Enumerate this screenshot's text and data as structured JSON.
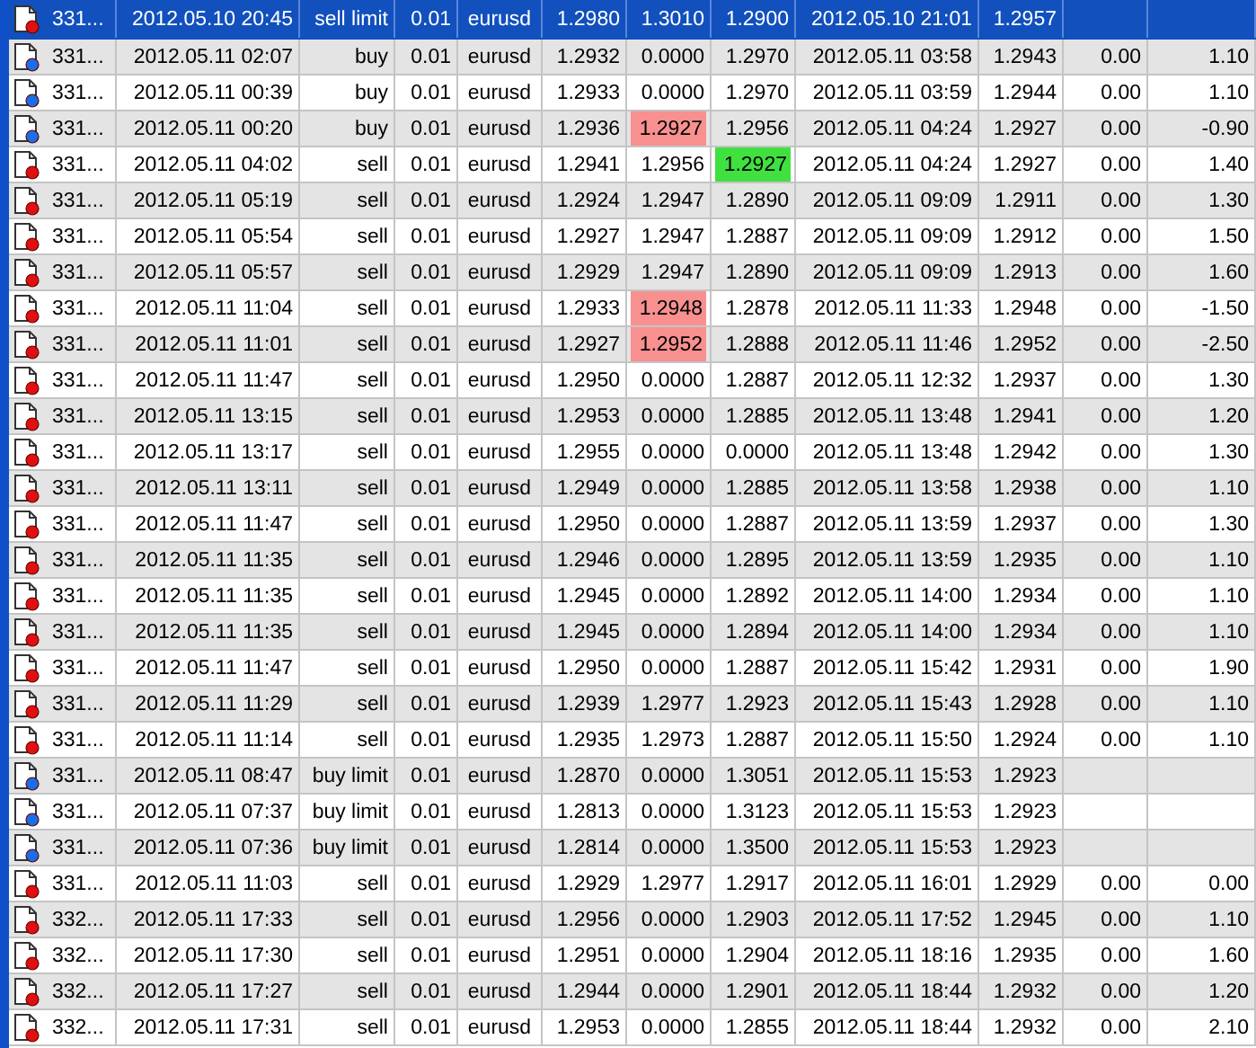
{
  "table": {
    "rows": [
      {
        "kind": "sell",
        "selected": true,
        "hit_column_7": false,
        "hit_column_8": false,
        "cells": [
          "331...",
          "2012.05.10 20:45",
          "sell limit",
          "0.01",
          "eurusd",
          "1.2980",
          "1.3010",
          "1.2900",
          "2012.05.10 21:01",
          "1.2957"
        ]
      },
      {
        "kind": "buy",
        "selected": false,
        "hit_column_7": false,
        "hit_column_8": false,
        "cells": [
          "331...",
          "2012.05.11 02:07",
          "buy",
          "0.01",
          "eurusd",
          "1.2932",
          "0.0000",
          "1.2970",
          "2012.05.11 03:58",
          "1.2943",
          "0.00",
          "1.10"
        ]
      },
      {
        "kind": "buy",
        "selected": false,
        "hit_column_7": false,
        "hit_column_8": false,
        "cells": [
          "331...",
          "2012.05.11 00:39",
          "buy",
          "0.01",
          "eurusd",
          "1.2933",
          "0.0000",
          "1.2970",
          "2012.05.11 03:59",
          "1.2944",
          "0.00",
          "1.10"
        ]
      },
      {
        "kind": "buy",
        "selected": false,
        "hit_column_7": true,
        "hit_column_8": false,
        "cells": [
          "331...",
          "2012.05.11 00:20",
          "buy",
          "0.01",
          "eurusd",
          "1.2936",
          "1.2927",
          "1.2956",
          "2012.05.11 04:24",
          "1.2927",
          "0.00",
          "-0.90"
        ]
      },
      {
        "kind": "sell",
        "selected": false,
        "hit_column_7": false,
        "hit_column_8": true,
        "cells": [
          "331...",
          "2012.05.11 04:02",
          "sell",
          "0.01",
          "eurusd",
          "1.2941",
          "1.2956",
          "1.2927",
          "2012.05.11 04:24",
          "1.2927",
          "0.00",
          "1.40"
        ]
      },
      {
        "kind": "sell",
        "selected": false,
        "hit_column_7": false,
        "hit_column_8": false,
        "cells": [
          "331...",
          "2012.05.11 05:19",
          "sell",
          "0.01",
          "eurusd",
          "1.2924",
          "1.2947",
          "1.2890",
          "2012.05.11 09:09",
          "1.2911",
          "0.00",
          "1.30"
        ]
      },
      {
        "kind": "sell",
        "selected": false,
        "hit_column_7": false,
        "hit_column_8": false,
        "cells": [
          "331...",
          "2012.05.11 05:54",
          "sell",
          "0.01",
          "eurusd",
          "1.2927",
          "1.2947",
          "1.2887",
          "2012.05.11 09:09",
          "1.2912",
          "0.00",
          "1.50"
        ]
      },
      {
        "kind": "sell",
        "selected": false,
        "hit_column_7": false,
        "hit_column_8": false,
        "cells": [
          "331...",
          "2012.05.11 05:57",
          "sell",
          "0.01",
          "eurusd",
          "1.2929",
          "1.2947",
          "1.2890",
          "2012.05.11 09:09",
          "1.2913",
          "0.00",
          "1.60"
        ]
      },
      {
        "kind": "sell",
        "selected": false,
        "hit_column_7": true,
        "hit_column_8": false,
        "cells": [
          "331...",
          "2012.05.11 11:04",
          "sell",
          "0.01",
          "eurusd",
          "1.2933",
          "1.2948",
          "1.2878",
          "2012.05.11 11:33",
          "1.2948",
          "0.00",
          "-1.50"
        ]
      },
      {
        "kind": "sell",
        "selected": false,
        "hit_column_7": true,
        "hit_column_8": false,
        "cells": [
          "331...",
          "2012.05.11 11:01",
          "sell",
          "0.01",
          "eurusd",
          "1.2927",
          "1.2952",
          "1.2888",
          "2012.05.11 11:46",
          "1.2952",
          "0.00",
          "-2.50"
        ]
      },
      {
        "kind": "sell",
        "selected": false,
        "hit_column_7": false,
        "hit_column_8": false,
        "cells": [
          "331...",
          "2012.05.11 11:47",
          "sell",
          "0.01",
          "eurusd",
          "1.2950",
          "0.0000",
          "1.2887",
          "2012.05.11 12:32",
          "1.2937",
          "0.00",
          "1.30"
        ]
      },
      {
        "kind": "sell",
        "selected": false,
        "hit_column_7": false,
        "hit_column_8": false,
        "cells": [
          "331...",
          "2012.05.11 13:15",
          "sell",
          "0.01",
          "eurusd",
          "1.2953",
          "0.0000",
          "1.2885",
          "2012.05.11 13:48",
          "1.2941",
          "0.00",
          "1.20"
        ]
      },
      {
        "kind": "sell",
        "selected": false,
        "hit_column_7": false,
        "hit_column_8": false,
        "cells": [
          "331...",
          "2012.05.11 13:17",
          "sell",
          "0.01",
          "eurusd",
          "1.2955",
          "0.0000",
          "0.0000",
          "2012.05.11 13:48",
          "1.2942",
          "0.00",
          "1.30"
        ]
      },
      {
        "kind": "sell",
        "selected": false,
        "hit_column_7": false,
        "hit_column_8": false,
        "cells": [
          "331...",
          "2012.05.11 13:11",
          "sell",
          "0.01",
          "eurusd",
          "1.2949",
          "0.0000",
          "1.2885",
          "2012.05.11 13:58",
          "1.2938",
          "0.00",
          "1.10"
        ]
      },
      {
        "kind": "sell",
        "selected": false,
        "hit_column_7": false,
        "hit_column_8": false,
        "cells": [
          "331...",
          "2012.05.11 11:47",
          "sell",
          "0.01",
          "eurusd",
          "1.2950",
          "0.0000",
          "1.2887",
          "2012.05.11 13:59",
          "1.2937",
          "0.00",
          "1.30"
        ]
      },
      {
        "kind": "sell",
        "selected": false,
        "hit_column_7": false,
        "hit_column_8": false,
        "cells": [
          "331...",
          "2012.05.11 11:35",
          "sell",
          "0.01",
          "eurusd",
          "1.2946",
          "0.0000",
          "1.2895",
          "2012.05.11 13:59",
          "1.2935",
          "0.00",
          "1.10"
        ]
      },
      {
        "kind": "sell",
        "selected": false,
        "hit_column_7": false,
        "hit_column_8": false,
        "cells": [
          "331...",
          "2012.05.11 11:35",
          "sell",
          "0.01",
          "eurusd",
          "1.2945",
          "0.0000",
          "1.2892",
          "2012.05.11 14:00",
          "1.2934",
          "0.00",
          "1.10"
        ]
      },
      {
        "kind": "sell",
        "selected": false,
        "hit_column_7": false,
        "hit_column_8": false,
        "cells": [
          "331...",
          "2012.05.11 11:35",
          "sell",
          "0.01",
          "eurusd",
          "1.2945",
          "0.0000",
          "1.2894",
          "2012.05.11 14:00",
          "1.2934",
          "0.00",
          "1.10"
        ]
      },
      {
        "kind": "sell",
        "selected": false,
        "hit_column_7": false,
        "hit_column_8": false,
        "cells": [
          "331...",
          "2012.05.11 11:47",
          "sell",
          "0.01",
          "eurusd",
          "1.2950",
          "0.0000",
          "1.2887",
          "2012.05.11 15:42",
          "1.2931",
          "0.00",
          "1.90"
        ]
      },
      {
        "kind": "sell",
        "selected": false,
        "hit_column_7": false,
        "hit_column_8": false,
        "cells": [
          "331...",
          "2012.05.11 11:29",
          "sell",
          "0.01",
          "eurusd",
          "1.2939",
          "1.2977",
          "1.2923",
          "2012.05.11 15:43",
          "1.2928",
          "0.00",
          "1.10"
        ]
      },
      {
        "kind": "sell",
        "selected": false,
        "hit_column_7": false,
        "hit_column_8": false,
        "cells": [
          "331...",
          "2012.05.11 11:14",
          "sell",
          "0.01",
          "eurusd",
          "1.2935",
          "1.2973",
          "1.2887",
          "2012.05.11 15:50",
          "1.2924",
          "0.00",
          "1.10"
        ]
      },
      {
        "kind": "buy",
        "selected": false,
        "hit_column_7": false,
        "hit_column_8": false,
        "cells": [
          "331...",
          "2012.05.11 08:47",
          "buy limit",
          "0.01",
          "eurusd",
          "1.2870",
          "0.0000",
          "1.3051",
          "2012.05.11 15:53",
          "1.2923"
        ]
      },
      {
        "kind": "buy",
        "selected": false,
        "hit_column_7": false,
        "hit_column_8": false,
        "cells": [
          "331...",
          "2012.05.11 07:37",
          "buy limit",
          "0.01",
          "eurusd",
          "1.2813",
          "0.0000",
          "1.3123",
          "2012.05.11 15:53",
          "1.2923"
        ]
      },
      {
        "kind": "buy",
        "selected": false,
        "hit_column_7": false,
        "hit_column_8": false,
        "cells": [
          "331...",
          "2012.05.11 07:36",
          "buy limit",
          "0.01",
          "eurusd",
          "1.2814",
          "0.0000",
          "1.3500",
          "2012.05.11 15:53",
          "1.2923"
        ]
      },
      {
        "kind": "sell",
        "selected": false,
        "hit_column_7": false,
        "hit_column_8": false,
        "cells": [
          "331...",
          "2012.05.11 11:03",
          "sell",
          "0.01",
          "eurusd",
          "1.2929",
          "1.2977",
          "1.2917",
          "2012.05.11 16:01",
          "1.2929",
          "0.00",
          "0.00"
        ]
      },
      {
        "kind": "sell",
        "selected": false,
        "hit_column_7": false,
        "hit_column_8": false,
        "cells": [
          "332...",
          "2012.05.11 17:33",
          "sell",
          "0.01",
          "eurusd",
          "1.2956",
          "0.0000",
          "1.2903",
          "2012.05.11 17:52",
          "1.2945",
          "0.00",
          "1.10"
        ]
      },
      {
        "kind": "sell",
        "selected": false,
        "hit_column_7": false,
        "hit_column_8": false,
        "cells": [
          "332...",
          "2012.05.11 17:30",
          "sell",
          "0.01",
          "eurusd",
          "1.2951",
          "0.0000",
          "1.2904",
          "2012.05.11 18:16",
          "1.2935",
          "0.00",
          "1.60"
        ]
      },
      {
        "kind": "sell",
        "selected": false,
        "hit_column_7": false,
        "hit_column_8": false,
        "cells": [
          "332...",
          "2012.05.11 17:27",
          "sell",
          "0.01",
          "eurusd",
          "1.2944",
          "0.0000",
          "1.2901",
          "2012.05.11 18:44",
          "1.2932",
          "0.00",
          "1.20"
        ]
      },
      {
        "kind": "sell",
        "selected": false,
        "hit_column_7": false,
        "hit_column_8": false,
        "cells": [
          "332...",
          "2012.05.11 17:31",
          "sell",
          "0.01",
          "eurusd",
          "1.2953",
          "0.0000",
          "1.2855",
          "2012.05.11 18:44",
          "1.2932",
          "0.00",
          "2.10"
        ]
      }
    ]
  }
}
